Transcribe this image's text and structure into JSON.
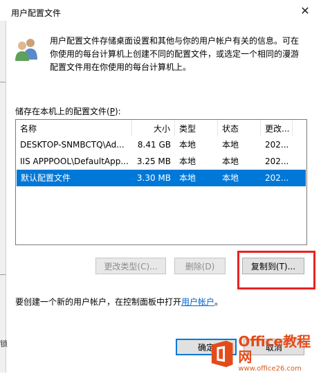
{
  "window": {
    "title": "用户配置文件",
    "close_glyph": "✕"
  },
  "info": {
    "text": "用户配置文件存储桌面设置和其他与你的用户帐户有关的信息。可在你使用的每台计算机上创建不同的配置文件，或选定一个相同的漫游配置文件用在你使用的每台计算机上。"
  },
  "profiles_label": {
    "text": "储存在本机上的配置文件(",
    "key": "P",
    "suffix": "):"
  },
  "table": {
    "columns": [
      "名称",
      "大小",
      "类型",
      "状态",
      "更改..."
    ],
    "rows": [
      {
        "name": "DESKTOP-SNMBCTQ\\Ad...",
        "size": "8.41 GB",
        "type": "本地",
        "status": "本地",
        "modified": "202..."
      },
      {
        "name": "IIS APPPOOL\\DefaultApp...",
        "size": "3.25 MB",
        "type": "本地",
        "status": "本地",
        "modified": "202..."
      },
      {
        "name": "默认配置文件",
        "size": "3.30 MB",
        "type": "本地",
        "status": "本地",
        "modified": "202...",
        "selected": true
      }
    ]
  },
  "buttons": {
    "change_type": "更改类型(C)...",
    "delete": "删除(D)",
    "copy_to": "复制到(T)...",
    "ok": "确定",
    "cancel": "取消"
  },
  "create": {
    "prefix": "要创建一个新的用户帐户，在控制面板中打开",
    "link": "用户帐户",
    "suffix": "。"
  },
  "watermark": {
    "title_en": "Office",
    "title_cn": "教程网",
    "url": "www.office26.com"
  },
  "colors": {
    "selection": "#0078d7",
    "highlight": "#e82222",
    "link": "#0066cc",
    "watermark": "#e34c1a"
  },
  "left_strip": {
    "glyph": "锁"
  }
}
